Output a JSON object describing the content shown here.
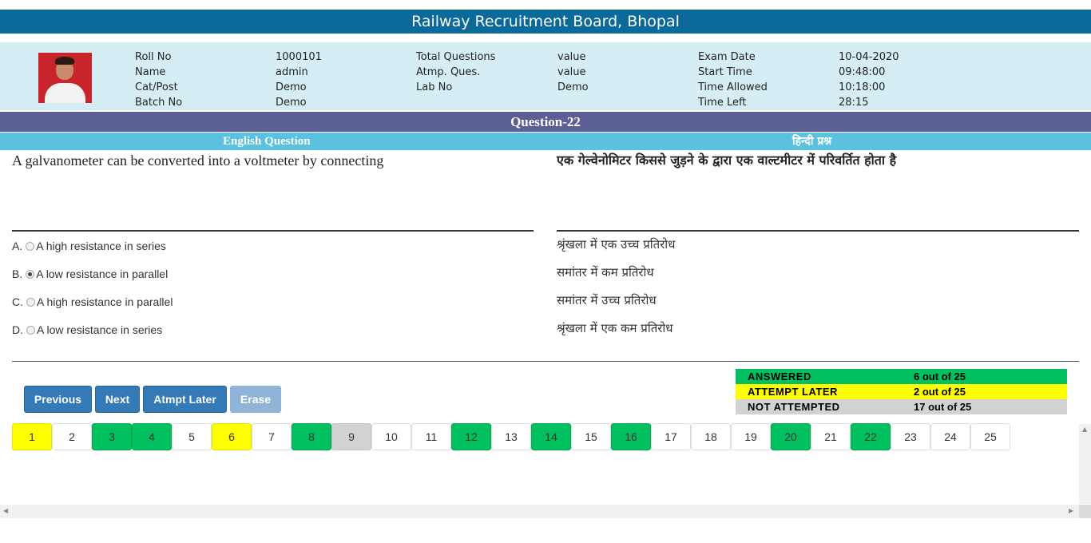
{
  "header": {
    "title": "Railway Recruitment Board, Bhopal"
  },
  "candidate": {
    "roll_label": "Roll No",
    "roll_value": "1000101",
    "name_label": "Name",
    "name_value": "admin",
    "catpost_label": "Cat/Post",
    "catpost_value": "Demo",
    "batch_label": "Batch No",
    "batch_value": "Demo"
  },
  "exam": {
    "total_label": "Total Questions",
    "total_value": "value",
    "atmp_label": "Atmp. Ques.",
    "atmp_value": "value",
    "lab_label": "Lab No",
    "lab_value": "Demo",
    "date_label": "Exam Date",
    "date_value": "10-04-2020",
    "start_label": "Start Time",
    "start_value": "09:48:00",
    "allowed_label": "Time Allowed",
    "allowed_value": "10:18:00",
    "left_label": "Time Left",
    "left_value": "28:15"
  },
  "question": {
    "heading": "Question-22",
    "english_label": "English Question",
    "hindi_label": "हिन्दी प्रश्न",
    "text_en": "A galvanometer can be converted into a voltmeter by connecting",
    "text_hi": "एक गेल्वेनोमिटर किससे जुड़ने के द्वारा एक वाल्टमीटर में परिवर्तित होता है",
    "options": [
      {
        "letter": "A.",
        "text_en": "A high resistance in series",
        "text_hi": "श्रृंखला में एक उच्च प्रतिरोध",
        "selected": false
      },
      {
        "letter": "B.",
        "text_en": "A low resistance in parallel",
        "text_hi": "समांतर में कम प्रतिरोध",
        "selected": true
      },
      {
        "letter": "C.",
        "text_en": "A high resistance in parallel",
        "text_hi": "समांतर में उच्च प्रतिरोध",
        "selected": false
      },
      {
        "letter": "D.",
        "text_en": "A low resistance in series",
        "text_hi": "श्रृंखला में एक कम प्रतिरोध",
        "selected": false
      }
    ]
  },
  "buttons": {
    "previous": "Previous",
    "next": "Next",
    "attempt_later": "Atmpt Later",
    "erase": "Erase"
  },
  "status": {
    "answered_label": "ANSWERED",
    "answered_value": "6 out of 25",
    "answered_color": "#00c05f",
    "later_label": "ATTEMPT LATER",
    "later_value": "2 out of 25",
    "later_color": "#ffff00",
    "not_label": "NOT ATTEMPTED",
    "not_value": "17 out of 25",
    "not_color": "#d2d2d2"
  },
  "palette": [
    {
      "n": "1",
      "state": "later"
    },
    {
      "n": "2",
      "state": "none"
    },
    {
      "n": "3",
      "state": "answered"
    },
    {
      "n": "4",
      "state": "answered"
    },
    {
      "n": "5",
      "state": "none"
    },
    {
      "n": "6",
      "state": "later"
    },
    {
      "n": "7",
      "state": "none"
    },
    {
      "n": "8",
      "state": "answered"
    },
    {
      "n": "9",
      "state": "current"
    },
    {
      "n": "10",
      "state": "none"
    },
    {
      "n": "11",
      "state": "none"
    },
    {
      "n": "12",
      "state": "answered"
    },
    {
      "n": "13",
      "state": "none"
    },
    {
      "n": "14",
      "state": "answered"
    },
    {
      "n": "15",
      "state": "none"
    },
    {
      "n": "16",
      "state": "answered"
    },
    {
      "n": "17",
      "state": "none"
    },
    {
      "n": "18",
      "state": "none"
    },
    {
      "n": "19",
      "state": "none"
    },
    {
      "n": "20",
      "state": "answered"
    },
    {
      "n": "21",
      "state": "none"
    },
    {
      "n": "22",
      "state": "answered"
    },
    {
      "n": "23",
      "state": "none"
    },
    {
      "n": "24",
      "state": "none"
    },
    {
      "n": "25",
      "state": "none"
    }
  ]
}
